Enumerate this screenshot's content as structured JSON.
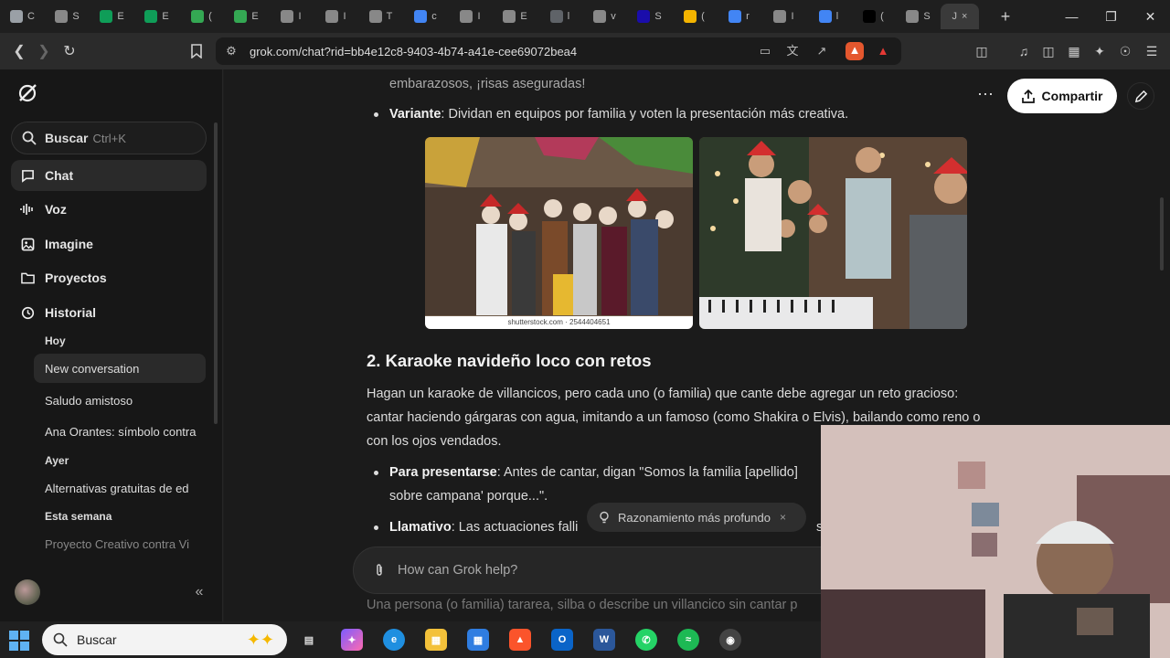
{
  "browser": {
    "url": "grok.com/chat?rid=bb4e12c8-9403-4b74-a41e-cee69072bea4",
    "tabs": [
      {
        "letter": "C",
        "color": "#9aa0a6"
      },
      {
        "letter": "S",
        "color": "#888888"
      },
      {
        "letter": "E",
        "color": "#0f9d58"
      },
      {
        "letter": "E",
        "color": "#0f9d58"
      },
      {
        "letter": "(",
        "color": "#34a853"
      },
      {
        "letter": "E",
        "color": "#34a853"
      },
      {
        "letter": "I",
        "color": "#888888"
      },
      {
        "letter": "I",
        "color": "#888888"
      },
      {
        "letter": "T",
        "color": "#888888"
      },
      {
        "letter": "c",
        "color": "#4285f4"
      },
      {
        "letter": "I",
        "color": "#888888"
      },
      {
        "letter": "E",
        "color": "#888888"
      },
      {
        "letter": "l",
        "color": "#5f6368"
      },
      {
        "letter": "v",
        "color": "#888888"
      },
      {
        "letter": "S",
        "color": "#1a0dab"
      },
      {
        "letter": "(",
        "color": "#f4b400"
      },
      {
        "letter": "r",
        "color": "#4285f4"
      },
      {
        "letter": "I",
        "color": "#888888"
      },
      {
        "letter": "l",
        "color": "#4285f4"
      },
      {
        "letter": "(",
        "color": "#000000"
      },
      {
        "letter": "S",
        "color": "#888888"
      }
    ],
    "active_tab_letter": "J"
  },
  "sidebar": {
    "search_label": "Buscar",
    "search_shortcut": "Ctrl+K",
    "nav": [
      {
        "label": "Chat",
        "icon": "chat-icon"
      },
      {
        "label": "Voz",
        "icon": "voice-icon"
      },
      {
        "label": "Imagine",
        "icon": "image-icon"
      },
      {
        "label": "Proyectos",
        "icon": "folder-icon"
      },
      {
        "label": "Historial",
        "icon": "history-icon"
      }
    ],
    "history": {
      "today": "Hoy",
      "today_items": [
        "New conversation",
        "Saludo amistoso",
        "Ana Orantes: símbolo contra"
      ],
      "yesterday": "Ayer",
      "yesterday_items": [
        "Alternativas gratuitas de ed"
      ],
      "week": "Esta semana",
      "week_items": [
        "Proyecto Creativo contra Vi"
      ]
    }
  },
  "header": {
    "share_label": "Compartir"
  },
  "content": {
    "top_line": "embarazosos, ¡risas aseguradas!",
    "variant_bold": "Variante",
    "variant_text": ": Dividan en equipos por familia y voten la presentación más creativa.",
    "image_caption": "shutterstock.com · 2544404651",
    "heading": "2. Karaoke navideño loco con retos",
    "para_line1": "Hagan un karaoke de villancicos, pero cada uno (o familia) que cante debe agregar un reto gracioso:",
    "para_line2": "cantar haciendo gárgaras con agua, imitando a un famoso (como Shakira o Elvis), bailando como reno o",
    "para_line3": "con los ojos vendados.",
    "present_bold": "Para presentarse",
    "present_text": ": Antes de cantar, digan \"Somos la familia [apellido]",
    "present_line2": "sobre campana' porque...\".",
    "llamativo_bold": "Llamativo",
    "llamativo_text": ": Las actuaciones falli",
    "llamativo_tail": "sí r",
    "bottom_line": "Una persona (o familia) tararea, silba o describe un villancico sin cantar p"
  },
  "pill": {
    "label": "Razonamiento más profundo",
    "close": "×"
  },
  "composer": {
    "placeholder": "How can Grok help?"
  },
  "taskbar": {
    "search_label": "Buscar"
  }
}
